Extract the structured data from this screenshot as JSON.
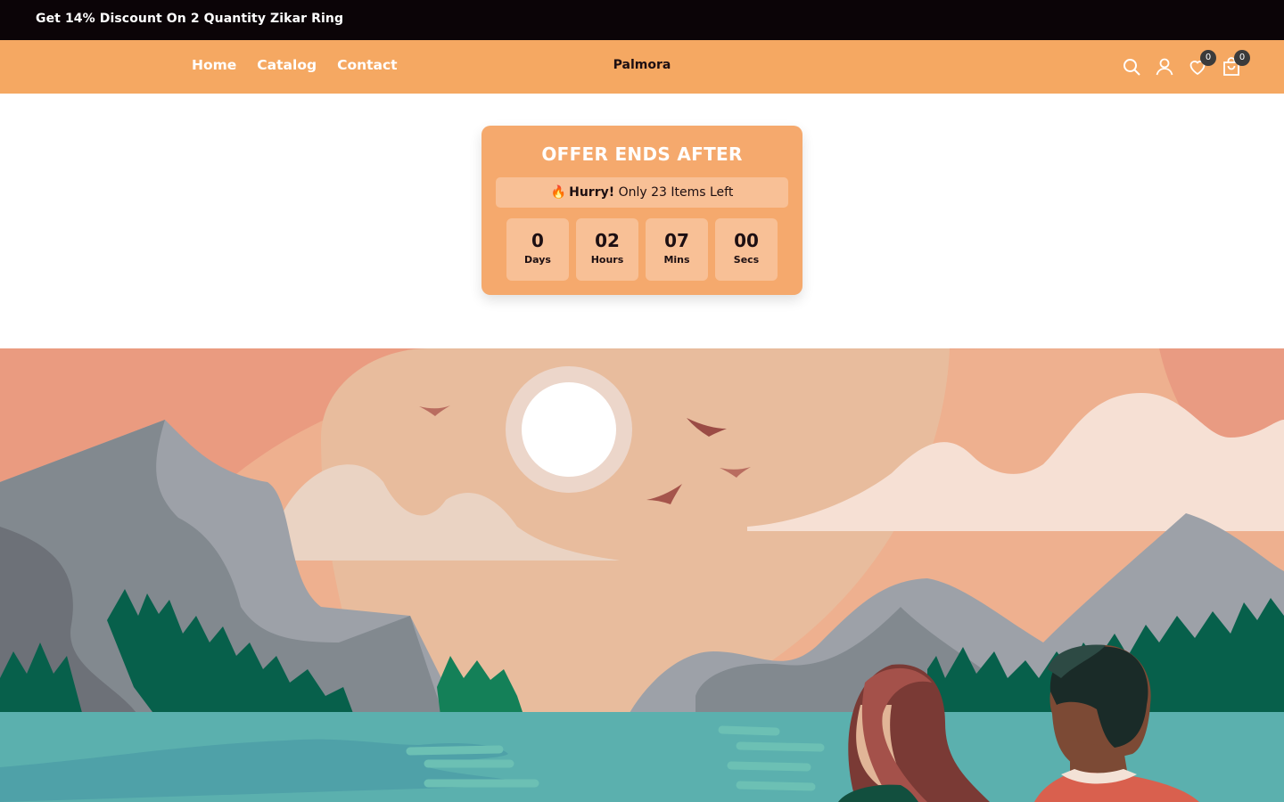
{
  "announcement": {
    "text": "Get 14% Discount On 2 Quantity Zikar Ring"
  },
  "header": {
    "nav": [
      "Home",
      "Catalog",
      "Contact"
    ],
    "brand": "Palmora",
    "icons": {
      "search": "search-icon",
      "account": "account-icon",
      "wishlist": "heart-icon",
      "cart": "bag-icon"
    },
    "wishlist_count": "0",
    "cart_count": "0"
  },
  "offer": {
    "title": "OFFER ENDS AFTER",
    "hurry_icon": "🔥",
    "hurry_bold": "Hurry!",
    "hurry_rest": "Only 23 Items Left",
    "countdown": [
      {
        "value": "0",
        "label": "Days"
      },
      {
        "value": "02",
        "label": "Hours"
      },
      {
        "value": "07",
        "label": "Mins"
      },
      {
        "value": "00",
        "label": "Secs"
      }
    ]
  },
  "colors": {
    "header_bg": "#f5a862",
    "announce_bg": "#0b0407",
    "offer_bg": "#f5a96d",
    "timer_bg": "#f8c096"
  }
}
